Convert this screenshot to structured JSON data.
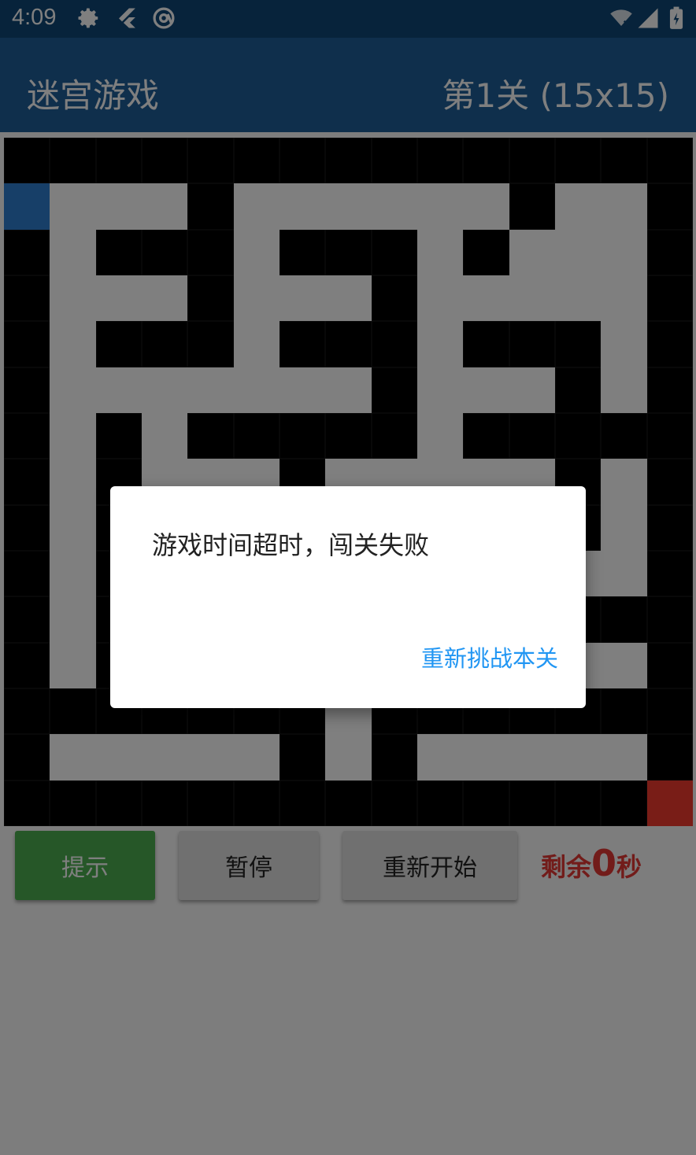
{
  "status_bar": {
    "time": "4:09",
    "left_icons": [
      "gear-icon",
      "flutter-icon",
      "at-sign-icon"
    ],
    "right_icons": [
      "wifi-icon",
      "cell-signal-icon",
      "battery-icon"
    ]
  },
  "app_bar": {
    "title": "迷宫游戏",
    "level": "第1关 (15x15)",
    "color": "#1e5e99"
  },
  "maze": {
    "size": 15,
    "grid": [
      "111111111111111",
      "S00010000001001",
      "101110111010001",
      "100010001000001",
      "101110111011101",
      "100000001000101",
      "101011111011111",
      "101000100000101",
      "101000000000101",
      "101000000000001",
      "101000000001111",
      "101000000000001",
      "111111101111111",
      "100000101000001",
      "11111111111111E"
    ],
    "colors": {
      "wall": "#000000",
      "path": "#ffffff",
      "start": "#2f7fd0",
      "end": "#f23a2e"
    }
  },
  "controls": {
    "hint_label": "提示",
    "pause_label": "暂停",
    "restart_label": "重新开始",
    "remaining_prefix": "剩余",
    "remaining_value": "0",
    "remaining_suffix": "秒",
    "hint_color": "#4caf50",
    "remaining_color": "#e53935"
  },
  "dialog": {
    "message": "游戏时间超时，闯关失败",
    "action_label": "重新挑战本关",
    "action_color": "#2196f3"
  }
}
